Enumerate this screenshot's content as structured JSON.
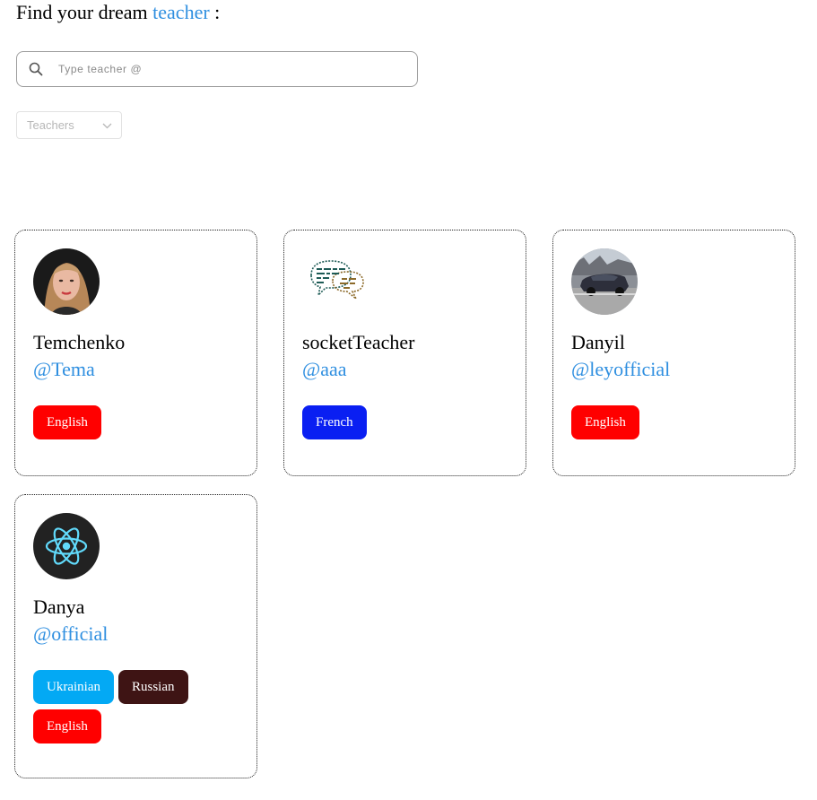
{
  "header": {
    "prefix": "Find your dream",
    "accent": "teacher",
    "suffix": ":",
    "accent_color": "#2f8fe0"
  },
  "search": {
    "placeholder": "Type teacher @",
    "value": "",
    "icon": "search-icon"
  },
  "filter": {
    "placeholder": "Teachers",
    "icon": "chevron-down-icon"
  },
  "teachers": [
    {
      "name": "Temchenko",
      "handle": "@Tema",
      "avatar": "woman-portrait",
      "languages": [
        {
          "label": "English",
          "color": "#ff0000"
        }
      ]
    },
    {
      "name": "socketTeacher",
      "handle": "@aaa",
      "avatar": "speech-bubbles-logo",
      "languages": [
        {
          "label": "French",
          "color": "#0a1ff2"
        }
      ]
    },
    {
      "name": "Danyil",
      "handle": "@leyofficial",
      "avatar": "car-photo",
      "languages": [
        {
          "label": "English",
          "color": "#ff0000"
        }
      ]
    },
    {
      "name": "Danya",
      "handle": "@official",
      "avatar": "react-logo",
      "languages": [
        {
          "label": "Ukrainian",
          "color": "#03a9f4"
        },
        {
          "label": "Russian",
          "color": "#3e1414"
        },
        {
          "label": "English",
          "color": "#ff0000"
        }
      ]
    }
  ]
}
